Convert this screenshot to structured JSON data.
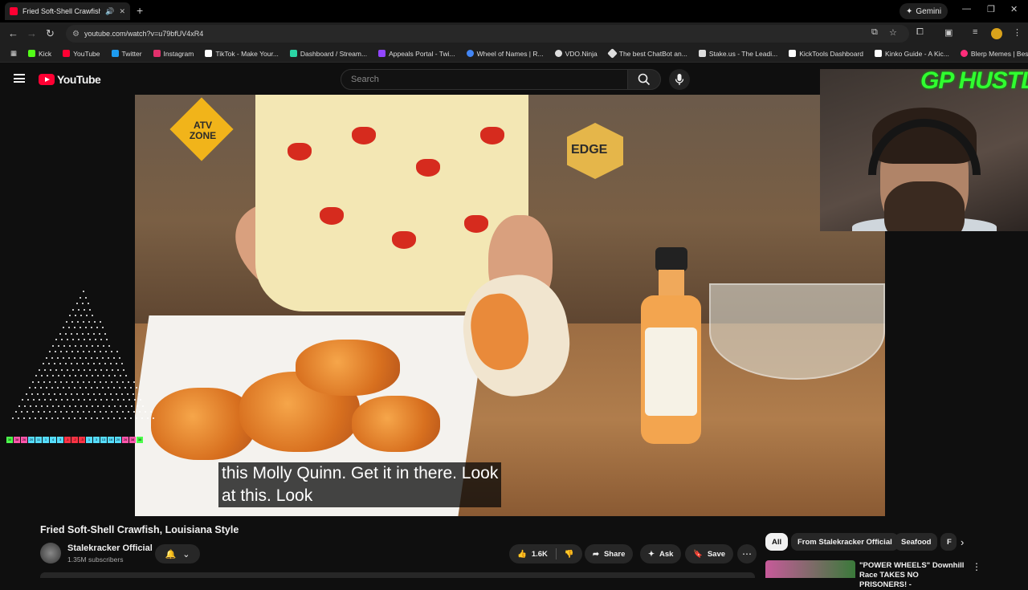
{
  "browser": {
    "tab_title": "Fried Soft-Shell Crawfish, Lo",
    "new_tab_symbol": "+",
    "gemini_label": "Gemini",
    "url": "youtube.com/watch?v=u79bfUV4xR4",
    "bookmarks": [
      {
        "label": "Kick",
        "color": "#53fc18"
      },
      {
        "label": "YouTube",
        "color": "#ff0033"
      },
      {
        "label": "Twitter",
        "color": "#1d9bf0"
      },
      {
        "label": "Instagram",
        "color": "#e1306c"
      },
      {
        "label": "TikTok - Make Your...",
        "color": "#ffffff"
      },
      {
        "label": "Dashboard / Stream...",
        "color": "#2bd4a4"
      },
      {
        "label": "Appeals Portal - Twi...",
        "color": "#9146ff"
      },
      {
        "label": "Wheel of Names | R...",
        "color": "#4285f4"
      },
      {
        "label": "VDO.Ninja",
        "color": "#dddddd"
      },
      {
        "label": "The best ChatBot an...",
        "color": "#dddddd"
      },
      {
        "label": "Stake.us - The Leadi...",
        "color": "#dddddd"
      },
      {
        "label": "KickTools Dashboard",
        "color": "#ffffff"
      },
      {
        "label": "Kinko Guide - A Kic...",
        "color": "#ffffff"
      },
      {
        "label": "Blerp Memes | Best...",
        "color": "#ff2d7a"
      }
    ]
  },
  "youtube": {
    "logo_text": "YouTube",
    "search_placeholder": "Search",
    "caption_line1": "this Molly Quinn. Get it in there. Look",
    "caption_line2": "at this. Look",
    "sign_atv": "ATV ZONE",
    "sign_edge": "EDGE",
    "overlay_title": "GP HUSTLA",
    "video_title": "Fried Soft-Shell Crawfish, Louisiana Style",
    "channel_name": "Stalekracker Official",
    "subscribers": "1.35M subscribers",
    "likes": "1.6K",
    "share_label": "Share",
    "ask_label": "Ask",
    "save_label": "Save",
    "chips": [
      "All",
      "From Stalekracker Official",
      "Seafood",
      "F"
    ],
    "rec_title": "\"POWER WHEELS\" Downhill Race TAKES NO PRISONERS! -",
    "eq_values": [
      "30",
      "38",
      "26",
      "20",
      "11",
      "1",
      "4",
      "3",
      "-1",
      "-2",
      "-3",
      "1",
      "3",
      "13",
      "16",
      "20",
      "26",
      "38",
      "30"
    ],
    "accent": "#ff0033"
  }
}
